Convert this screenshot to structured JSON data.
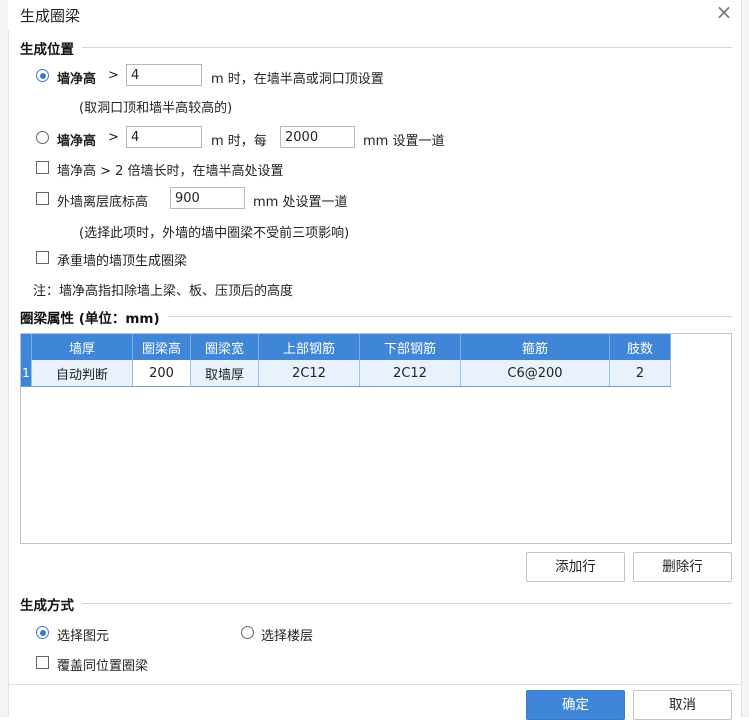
{
  "dialog": {
    "title": "生成圈梁",
    "close_glyph": "×"
  },
  "section_position": {
    "title": "生成位置",
    "opt1": {
      "label": "墙净高",
      "op": ">",
      "value": "4",
      "suffix": "m 时，在墙半高或洞口顶设置",
      "note": "(取洞口顶和墙半高较高的)",
      "checked": true
    },
    "opt2": {
      "label": "墙净高",
      "op": ">",
      "value": "4",
      "mid": "m 时，每",
      "value2": "2000",
      "suffix": "mm 设置一道",
      "checked": false
    },
    "opt3": {
      "label": "墙净高 > 2 倍墙长时，在墙半高处设置",
      "checked": false
    },
    "opt4": {
      "label": "外墙离层底标高",
      "value": "900",
      "suffix": "mm 处设置一道",
      "note": "(选择此项时，外墙的墙中圈梁不受前三项影响)",
      "checked": false
    },
    "opt5": {
      "label": "承重墙的墙顶生成圈梁",
      "checked": false
    },
    "footnote": "注：墙净高指扣除墙上梁、板、压顶后的高度"
  },
  "section_props": {
    "title": "圈梁属性 (单位：mm)",
    "columns": [
      "墙厚",
      "圈梁高",
      "圈梁宽",
      "上部钢筋",
      "下部钢筋",
      "箍筋",
      "肢数"
    ],
    "rows": [
      {
        "index": "1",
        "cells": [
          "自动判断",
          "200",
          "取墙厚",
          "2C12",
          "2C12",
          "C6@200",
          "2"
        ]
      }
    ],
    "add_row": "添加行",
    "delete_row": "删除行"
  },
  "section_method": {
    "title": "生成方式",
    "select_element": "选择图元",
    "select_floor": "选择楼层",
    "overwrite": "覆盖同位置圈梁"
  },
  "footer": {
    "ok": "确定",
    "cancel": "取消"
  },
  "colors": {
    "accent": "#3f86d8"
  }
}
